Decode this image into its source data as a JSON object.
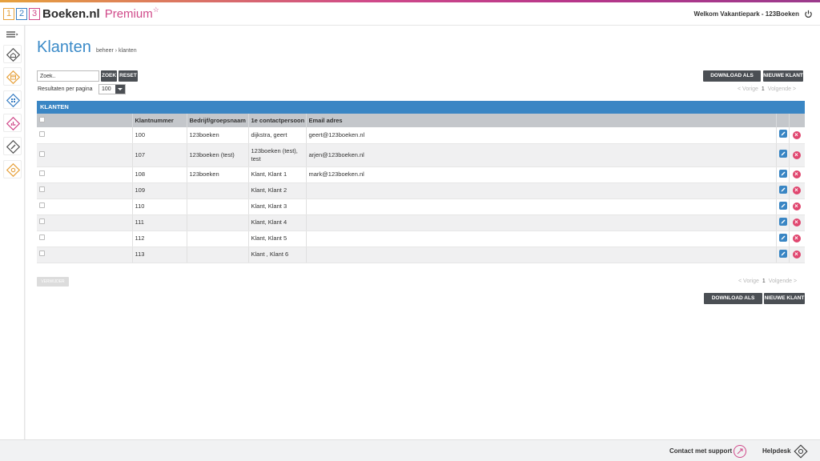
{
  "header": {
    "logo_digits": [
      "1",
      "2",
      "3"
    ],
    "brand": "Boeken.nl",
    "premium": "Premium",
    "star": "☆",
    "welcome": "Welkom Vakantiepark - 123Boeken"
  },
  "sidebar": {
    "items": [
      {
        "icon": "home-icon",
        "color": "#555555"
      },
      {
        "icon": "calendar-icon",
        "color": "#e6a13c"
      },
      {
        "icon": "grid-icon",
        "color": "#3a7fc4"
      },
      {
        "icon": "chart-icon",
        "color": "#d04a8a"
      },
      {
        "icon": "ticket-icon",
        "color": "#555555"
      },
      {
        "icon": "settings-icon",
        "color": "#e6a13c"
      }
    ]
  },
  "page": {
    "title": "Klanten",
    "breadcrumb": "beheer › klanten"
  },
  "search": {
    "placeholder": "Zoek..",
    "search_label": "ZOEK",
    "reset_label": "RESET"
  },
  "results_per_page": {
    "label": "Resultaten per pagina",
    "value": "100"
  },
  "actions": {
    "download_label": "DOWNLOAD ALS EXCEL",
    "new_label": "NIEUWE KLANT",
    "delete_label": "VERWIJDER"
  },
  "pager": {
    "prev": "< Vorige",
    "page": "1",
    "next": "Volgende >"
  },
  "table": {
    "title": "KLANTEN",
    "columns": [
      "Klantnummer",
      "Bedrijf/groepsnaam",
      "1e contactpersoon",
      "Email adres"
    ],
    "rows": [
      {
        "nummer": "100",
        "bedrijf": "123boeken",
        "contact": "dijkstra, geert",
        "email": "geert@123boeken.nl"
      },
      {
        "nummer": "107",
        "bedrijf": "123boeken (test)",
        "contact": "123boeken (test), test",
        "email": "arjen@123boeken.nl"
      },
      {
        "nummer": "108",
        "bedrijf": "123boeken",
        "contact": "Klant, Klant 1",
        "email": "mark@123boeken.nl"
      },
      {
        "nummer": "109",
        "bedrijf": "",
        "contact": "Klant, Klant 2",
        "email": ""
      },
      {
        "nummer": "110",
        "bedrijf": "",
        "contact": "Klant, Klant 3",
        "email": ""
      },
      {
        "nummer": "111",
        "bedrijf": "",
        "contact": "Klant, Klant 4",
        "email": ""
      },
      {
        "nummer": "112",
        "bedrijf": "",
        "contact": "Klant, Klant 5",
        "email": ""
      },
      {
        "nummer": "113",
        "bedrijf": "",
        "contact": "Klant , Klant 6",
        "email": ""
      }
    ]
  },
  "footer": {
    "support": "Contact met support",
    "helpdesk": "Helpdesk"
  },
  "colors": {
    "accent": "#3a86c4",
    "brand_pink": "#d04a8a",
    "brand_orange": "#e6a13c",
    "dark_button": "#4b4f54",
    "delete": "#e0466f"
  }
}
